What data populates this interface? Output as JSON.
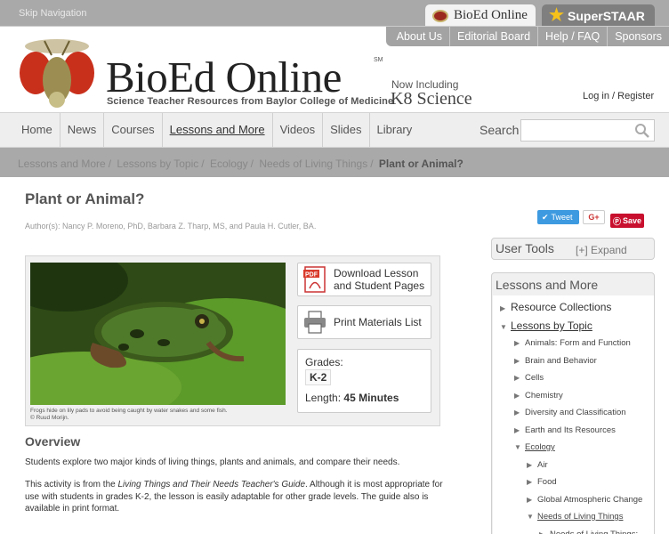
{
  "skip_nav": "Skip Navigation",
  "site_tabs": {
    "bioed": "BioEd Online",
    "superstaar": "SuperSTAAR"
  },
  "util_nav": [
    "About Us",
    "Editorial Board",
    "Help / FAQ",
    "Sponsors"
  ],
  "logo": {
    "title": "BioEd Online",
    "sm": "SM",
    "subtitle": "Science Teacher Resources from Baylor College of Medicine",
    "now_including": "Now Including",
    "k8": "K8 Science"
  },
  "auth": {
    "login": "Log in",
    "sep": "/",
    "register": "Register"
  },
  "nav": [
    "Home",
    "News",
    "Courses",
    "Lessons and More",
    "Videos",
    "Slides",
    "Library"
  ],
  "search": {
    "label": "Search",
    "placeholder": ""
  },
  "breadcrumb": [
    "Lessons and More",
    "Lessons by Topic",
    "Ecology",
    "Needs of Living Things"
  ],
  "breadcrumb_current": "Plant or Animal?",
  "page": {
    "title": "Plant or Animal?",
    "authors": "Author(s): Nancy P. Moreno, PhD, Barbara Z. Tharp, MS, and Paula H. Cutler, BA."
  },
  "share": {
    "tweet": "Tweet",
    "gplus": "G+",
    "save": "Save"
  },
  "lesson": {
    "caption_line1": "Frogs hide on lily pads to avoid being caught by water snakes and some fish.",
    "caption_line2": "© Ruud Morijn.",
    "download_l1": "Download Lesson",
    "download_l2": "and Student Pages",
    "print": "Print Materials List",
    "grades_label": "Grades:",
    "grades_value": "K-2",
    "length_label": "Length:",
    "length_value": "45 Minutes"
  },
  "overview": {
    "heading": "Overview",
    "p1": "Students explore two major kinds of living things, plants and animals, and compare their needs.",
    "p2_pre": "This activity is from the ",
    "p2_italic": "Living Things and Their Needs Teacher's Guide",
    "p2_post": ". Although it is most appropriate for use with students in grades K-2, the lesson is easily adaptable for other grade levels. The guide also is available in print format."
  },
  "sidebar": {
    "user_tools": "User Tools",
    "expand": "[+] Expand",
    "lessons_title": "Lessons and More",
    "tree": [
      {
        "label": "Resource Collections",
        "level": 0,
        "open": false
      },
      {
        "label": "Lessons by Topic",
        "level": 0,
        "open": true
      },
      {
        "label": "Animals: Form and Function",
        "level": 1,
        "open": false
      },
      {
        "label": "Brain and Behavior",
        "level": 1,
        "open": false
      },
      {
        "label": "Cells",
        "level": 1,
        "open": false
      },
      {
        "label": "Chemistry",
        "level": 1,
        "open": false
      },
      {
        "label": "Diversity and Classification",
        "level": 1,
        "open": false
      },
      {
        "label": "Earth and Its Resources",
        "level": 1,
        "open": false
      },
      {
        "label": "Ecology",
        "level": 1,
        "open": true
      },
      {
        "label": "Air",
        "level": 2,
        "open": false
      },
      {
        "label": "Food",
        "level": 2,
        "open": false
      },
      {
        "label": "Global Atmospheric Change",
        "level": 2,
        "open": false
      },
      {
        "label": "Needs of Living Things",
        "level": 2,
        "open": true
      },
      {
        "label": "Needs of Living Things:",
        "level": 3,
        "open": false
      }
    ]
  }
}
